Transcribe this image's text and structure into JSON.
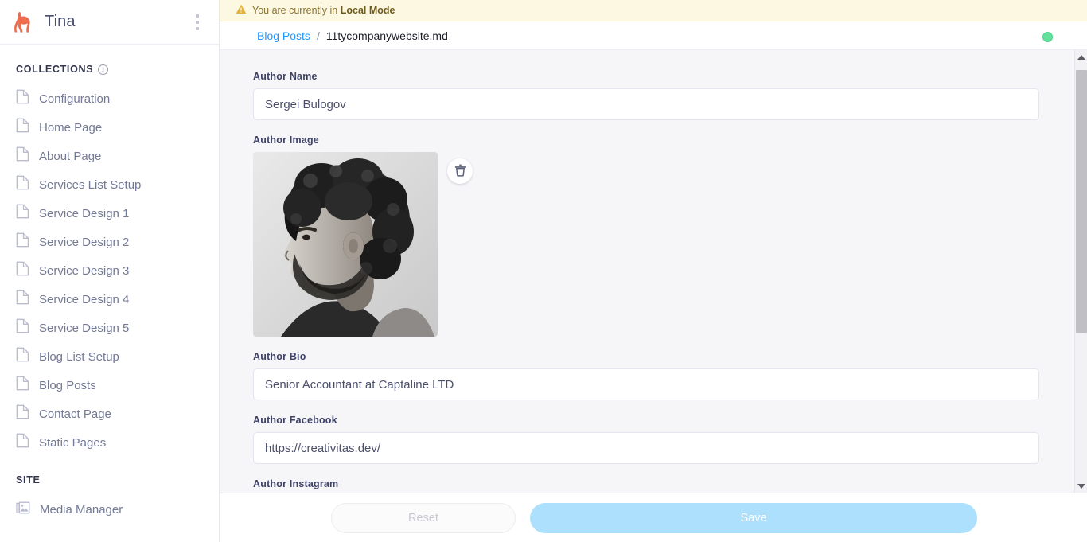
{
  "sidebar": {
    "brand_title": "Tina",
    "brand_icon": "llama-logo-icon",
    "menu_icon": "kebab-menu-icon",
    "collections_label": "COLLECTIONS",
    "collections_info_icon": "info-circle-icon",
    "site_label": "SITE",
    "collections": [
      {
        "label": "Configuration",
        "icon": "document-icon"
      },
      {
        "label": "Home Page",
        "icon": "document-icon"
      },
      {
        "label": "About Page",
        "icon": "document-icon"
      },
      {
        "label": "Services List Setup",
        "icon": "document-icon"
      },
      {
        "label": "Service Design 1",
        "icon": "document-icon"
      },
      {
        "label": "Service Design 2",
        "icon": "document-icon"
      },
      {
        "label": "Service Design 3",
        "icon": "document-icon"
      },
      {
        "label": "Service Design 4",
        "icon": "document-icon"
      },
      {
        "label": "Service Design 5",
        "icon": "document-icon"
      },
      {
        "label": "Blog List Setup",
        "icon": "document-icon"
      },
      {
        "label": "Blog Posts",
        "icon": "document-icon"
      },
      {
        "label": "Contact Page",
        "icon": "document-icon"
      },
      {
        "label": "Static Pages",
        "icon": "document-icon"
      }
    ],
    "site_items": [
      {
        "label": "Media Manager",
        "icon": "image-stack-icon"
      }
    ]
  },
  "banner": {
    "icon": "warning-triangle-icon",
    "text_prefix": "You are currently in ",
    "mode": "Local Mode"
  },
  "breadcrumb": {
    "parent": "Blog Posts",
    "separator": "/",
    "current": "11tycompanywebsite.md",
    "status_indicator": "green-status-dot"
  },
  "form": {
    "fields": [
      {
        "label": "Author Name",
        "value": "Sergei Bulogov",
        "type": "text"
      },
      {
        "label": "Author Image",
        "type": "image",
        "delete_icon": "trash-icon"
      },
      {
        "label": "Author Bio",
        "value": "Senior Accountant at Captaline LTD",
        "type": "text"
      },
      {
        "label": "Author Facebook",
        "value": "https://creativitas.dev/",
        "type": "text"
      },
      {
        "label": "Author Instagram",
        "value": "",
        "type": "text"
      }
    ]
  },
  "actions": {
    "reset_label": "Reset",
    "save_label": "Save"
  },
  "scrollbar": {
    "up_icon": "scroll-up-arrow-icon",
    "down_icon": "scroll-down-arrow-icon"
  },
  "colors": {
    "brand_orange": "#ee6c4d",
    "link_blue": "#2296fe",
    "save_blue": "#ade0fc",
    "banner_bg": "#fcf8e2",
    "status_green": "#63e19a"
  }
}
